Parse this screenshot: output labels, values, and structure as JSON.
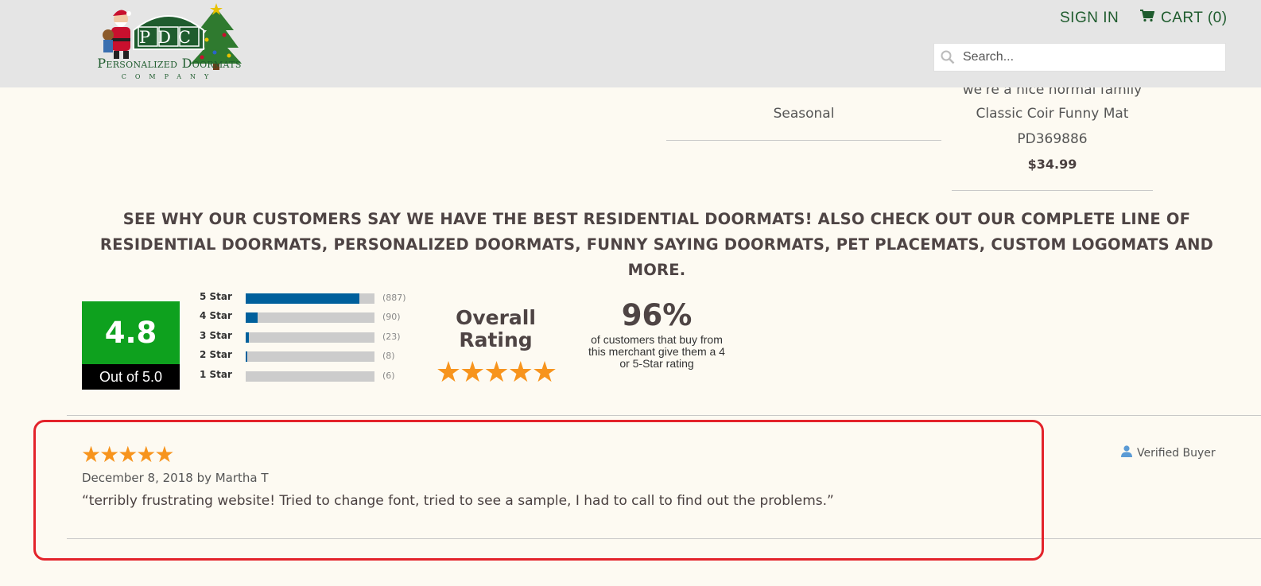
{
  "header": {
    "logo": {
      "monogram": "PDC",
      "name": "Personalized Doormats",
      "sub": "COMPANY"
    },
    "signin_label": "SIGN IN",
    "cart_label": "CART (0)",
    "search_placeholder": "Search...",
    "icons": {
      "search": "search-icon",
      "cart": "cart-icon"
    },
    "brand_color": "#1f5c2e"
  },
  "products": [
    {
      "name": "Seasonal"
    },
    {
      "cut_line": "we're a nice normal family",
      "name": "Classic Coir Funny Mat",
      "sku": "PD369886",
      "price": "$34.99"
    }
  ],
  "headline": "SEE WHY OUR CUSTOMERS SAY WE HAVE THE BEST RESIDENTIAL DOORMATS! ALSO CHECK OUT OUR COMPLETE LINE OF RESIDENTIAL DOORMATS, PERSONALIZED DOORMATS, FUNNY SAYING DOORMATS, PET PLACEMATS, CUSTOM LOGOMATS AND MORE.",
  "rating": {
    "score": "4.8",
    "out_of": "Out of 5.0",
    "distribution": [
      {
        "label": "5 Star",
        "count": "(887)",
        "fill": 0.88
      },
      {
        "label": "4 Star",
        "count": "(90)",
        "fill": 0.09
      },
      {
        "label": "3 Star",
        "count": "(23)",
        "fill": 0.023
      },
      {
        "label": "2 Star",
        "count": "(8)",
        "fill": 0.012
      },
      {
        "label": "1 Star",
        "count": "(6)",
        "fill": 0.0
      }
    ],
    "overall_line1": "Overall",
    "overall_line2": "Rating",
    "overall_stars": "★★★★★",
    "percent": "96%",
    "percent_desc": "of customers that buy from this merchant give them a 4 or 5-Star rating",
    "colors": {
      "score_bg": "#0ea11e",
      "bar_fill": "#00609c",
      "stars": "#f7941d"
    }
  },
  "review": {
    "stars": "★★★★★",
    "meta": "December 8, 2018 by Martha T",
    "text": "“terribly frustrating website! Tried to change font, tried to see a sample, I had to call to find out the problems.”",
    "verified_label": "Verified Buyer",
    "verified_icon": "user-icon",
    "highlight_color": "#e3232b"
  }
}
